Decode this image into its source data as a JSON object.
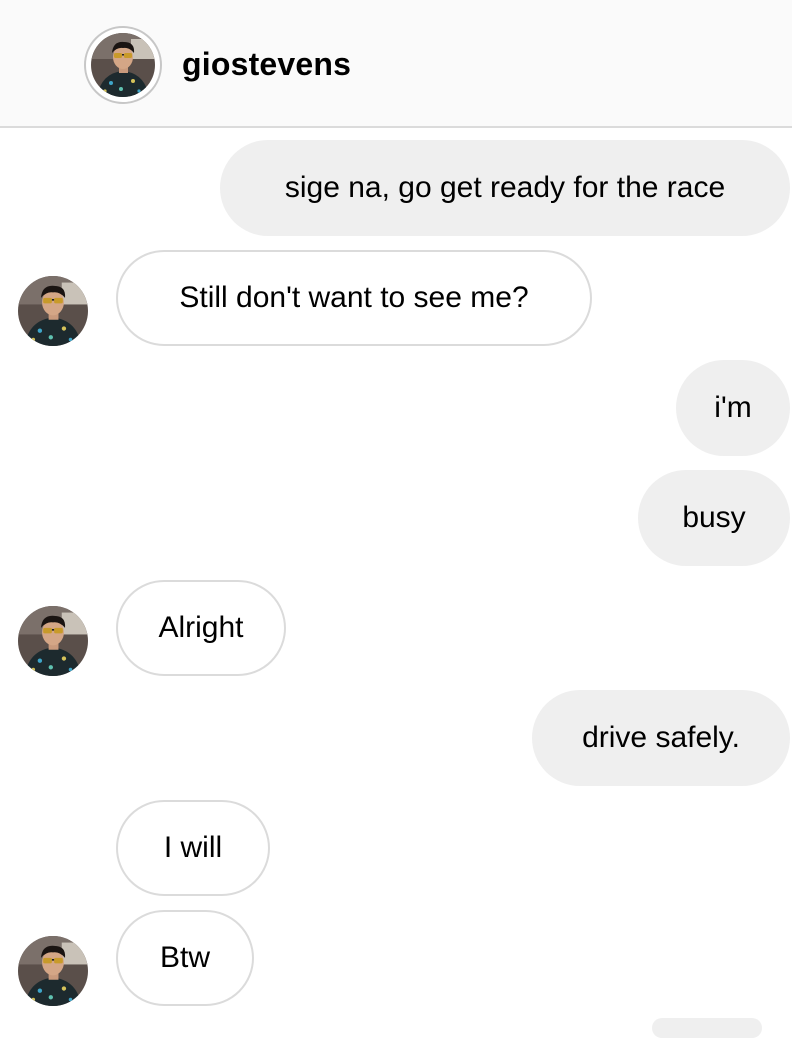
{
  "header": {
    "username": "giostevens",
    "avatar_icon": "profile-photo-avatar"
  },
  "messages": [
    {
      "from": "me",
      "text": "sige na, go get ready for the race"
    },
    {
      "from": "them",
      "text": "Still don't want to see me?"
    },
    {
      "from": "me",
      "text": "i'm"
    },
    {
      "from": "me",
      "text": "busy"
    },
    {
      "from": "them",
      "text": "Alright"
    },
    {
      "from": "me",
      "text": "drive safely."
    },
    {
      "from": "them",
      "text": "I will"
    },
    {
      "from": "them",
      "text": "Btw"
    }
  ],
  "colors": {
    "outgoing_bubble": "#efefef",
    "incoming_border": "#dbdbdb",
    "header_bg": "#fafafa"
  }
}
